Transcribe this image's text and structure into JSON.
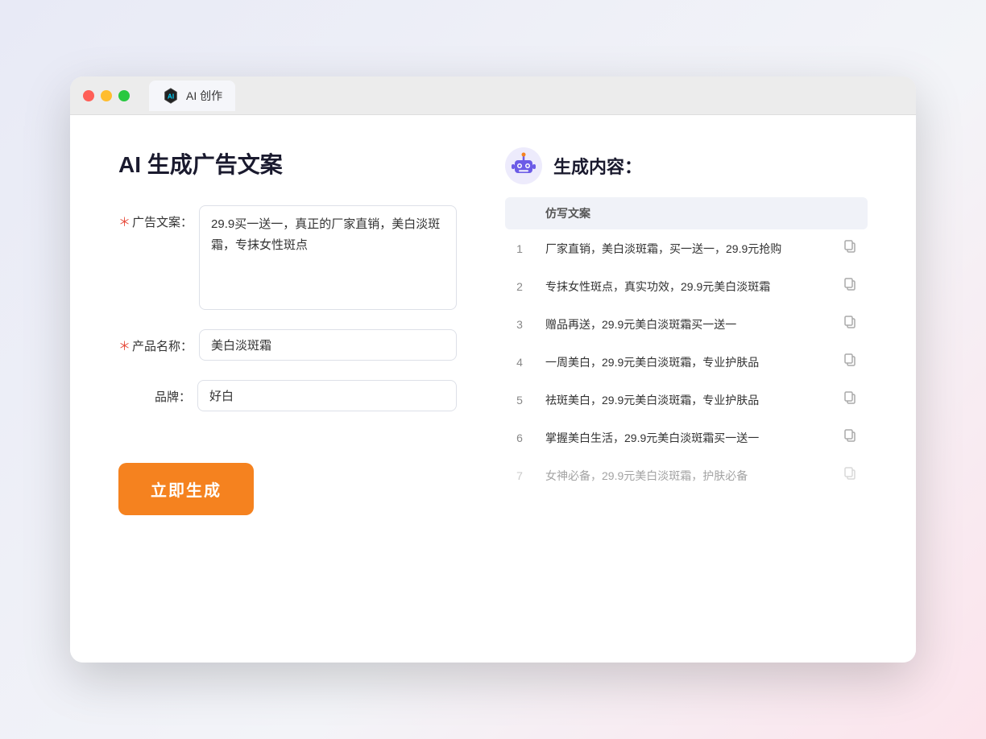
{
  "browser": {
    "tab_label": "AI 创作",
    "traffic_lights": [
      "red",
      "yellow",
      "green"
    ]
  },
  "left": {
    "page_title": "AI 生成广告文案",
    "form": {
      "ad_copy_label": "广告文案：",
      "ad_copy_required": "＊",
      "ad_copy_value": "29.9买一送一，真正的厂家直销，美白淡斑霜，专抹女性斑点",
      "product_name_label": "产品名称：",
      "product_name_required": "＊",
      "product_name_value": "美白淡斑霜",
      "brand_label": "品牌：",
      "brand_value": "好白"
    },
    "generate_btn_label": "立即生成"
  },
  "right": {
    "title": "生成内容：",
    "results_header": "仿写文案",
    "results": [
      {
        "num": 1,
        "text": "厂家直销，美白淡斑霜，买一送一，29.9元抢购"
      },
      {
        "num": 2,
        "text": "专抹女性斑点，真实功效，29.9元美白淡斑霜"
      },
      {
        "num": 3,
        "text": "赠品再送，29.9元美白淡斑霜买一送一"
      },
      {
        "num": 4,
        "text": "一周美白，29.9元美白淡斑霜，专业护肤品"
      },
      {
        "num": 5,
        "text": "祛斑美白，29.9元美白淡斑霜，专业护肤品"
      },
      {
        "num": 6,
        "text": "掌握美白生活，29.9元美白淡斑霜买一送一"
      },
      {
        "num": 7,
        "text": "女神必备，29.9元美白淡斑霜，护肤必备"
      }
    ]
  }
}
